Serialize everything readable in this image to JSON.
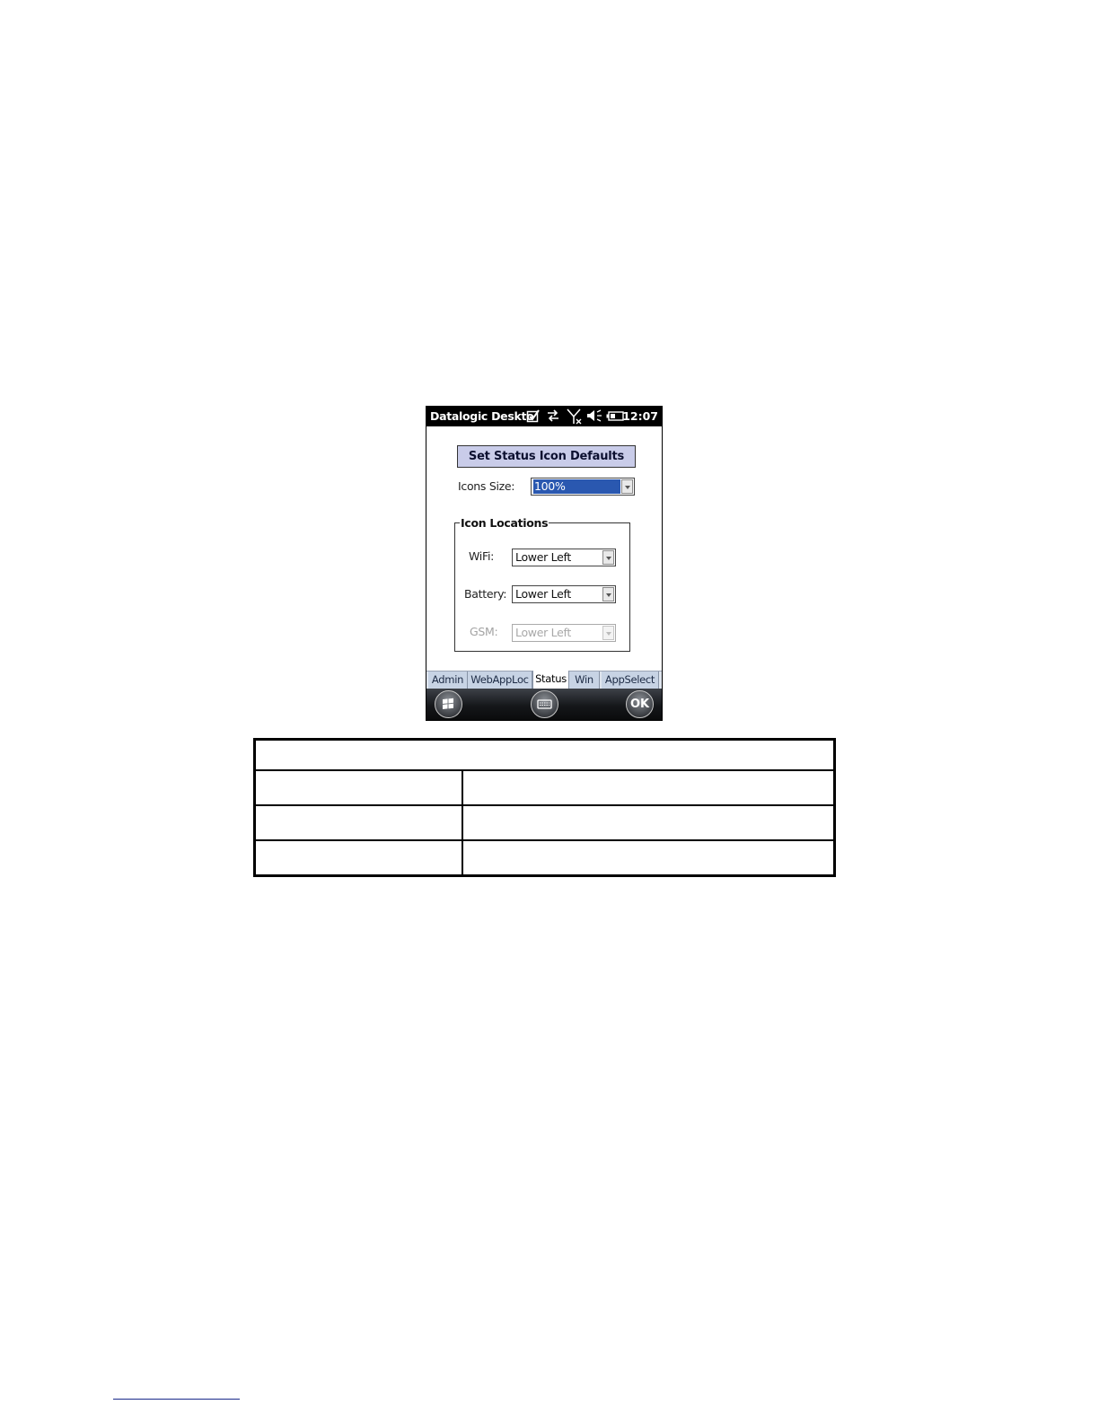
{
  "status_bar": {
    "title": "Datalogic Deskto",
    "time": "12:07",
    "icons": [
      "checkbox-icon",
      "sync-arrows-icon",
      "signal-off-icon",
      "speaker-muted-icon",
      "battery-icon"
    ]
  },
  "panel": {
    "header_button": "Set Status Icon Defaults",
    "icons_size_label": "Icons Size:",
    "icons_size_value": "100%",
    "group_title": "Icon Locations",
    "wifi_label": "WiFi:",
    "wifi_value": "Lower Left",
    "battery_label": "Battery:",
    "battery_value": "Lower Left",
    "gsm_label": "GSM:",
    "gsm_value": "Lower Left"
  },
  "tabs": [
    "Admin",
    "WebAppLoc",
    "Status",
    "Win",
    "AppSelect"
  ],
  "active_tab": "Status",
  "nav": {
    "start_icon": "windows-flag-icon",
    "keyboard_icon": "keyboard-icon",
    "ok_label": "OK"
  },
  "table": {
    "header": "",
    "rows": [
      [
        "",
        ""
      ],
      [
        "",
        ""
      ],
      [
        "",
        ""
      ]
    ]
  }
}
